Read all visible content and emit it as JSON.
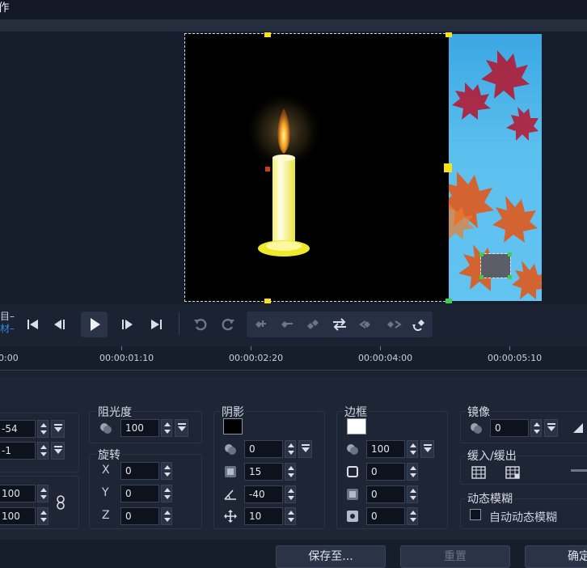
{
  "window": {
    "title": "]作"
  },
  "playback": {
    "mode_project": "目",
    "mode_clip": "材"
  },
  "ruler": {
    "ticks": [
      "0:00",
      "00:00:01:10",
      "00:00:02:20",
      "00:00:04:00",
      "00:00:05:10"
    ]
  },
  "position": {
    "x_value": "-54",
    "y_value": "-1"
  },
  "size": {
    "w_value": "100",
    "h_value": "100"
  },
  "opacity": {
    "title": "阻光度",
    "value": "100"
  },
  "rotation": {
    "title": "旋转",
    "x_label": "X",
    "x_value": "0",
    "y_label": "Y",
    "y_value": "0",
    "z_label": "Z",
    "z_value": "0"
  },
  "shadow": {
    "title": "阴影",
    "color": "#000000",
    "opacity_value": "0",
    "blur_value": "15",
    "angle_value": "-40",
    "distance_value": "10"
  },
  "border": {
    "title": "边框",
    "color": "#ffffff",
    "opacity_value": "100",
    "width_value": "0",
    "blur_value": "0",
    "corner_value": "0"
  },
  "mirror": {
    "title": "镜像",
    "value": "0"
  },
  "ease": {
    "title": "缓入/缓出"
  },
  "motion_blur": {
    "title": "动态模糊",
    "auto_label": "自动动态模糊",
    "checked": false
  },
  "footer": {
    "save_label": "保存至...",
    "reset_label": "重置",
    "ok_label": "确定"
  },
  "colors": {
    "accent": "#2d8fe0",
    "handle": "#f7e315",
    "panel": "#1e2535"
  }
}
